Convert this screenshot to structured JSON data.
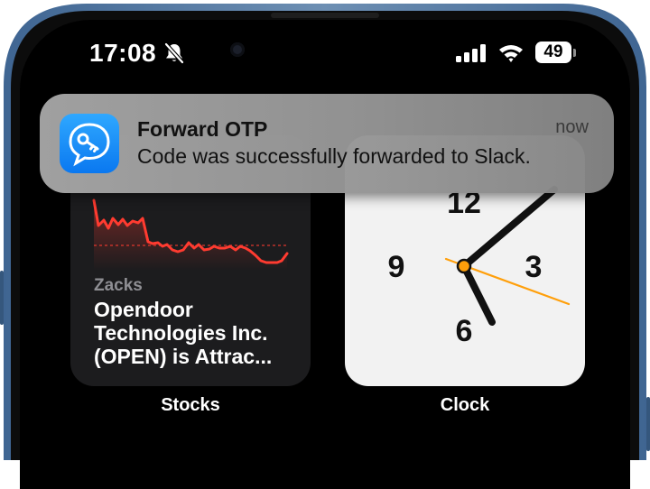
{
  "status_bar": {
    "time": "17:08",
    "battery": "49",
    "icons": [
      "bell-slash-icon",
      "signal-icon",
      "wifi-icon",
      "battery-icon"
    ]
  },
  "notification": {
    "app_icon": "key-message-icon",
    "title": "Forward OTP",
    "time": "now",
    "body": "Code was successfully forwarded to Slack."
  },
  "stocks_widget": {
    "source": "Zacks",
    "headline_line1": "Opendoor",
    "headline_line2": "Technologies Inc.",
    "headline_line3": "(OPEN) is Attrac...",
    "label": "Stocks",
    "accent": "#ff3b30"
  },
  "clock_widget": {
    "numerals": [
      "12",
      "3",
      "6",
      "9"
    ],
    "label": "Clock",
    "second_hand_color": "#ff9f0a"
  },
  "colors": {
    "frame": "#4a6f97",
    "screen": "#000000"
  }
}
